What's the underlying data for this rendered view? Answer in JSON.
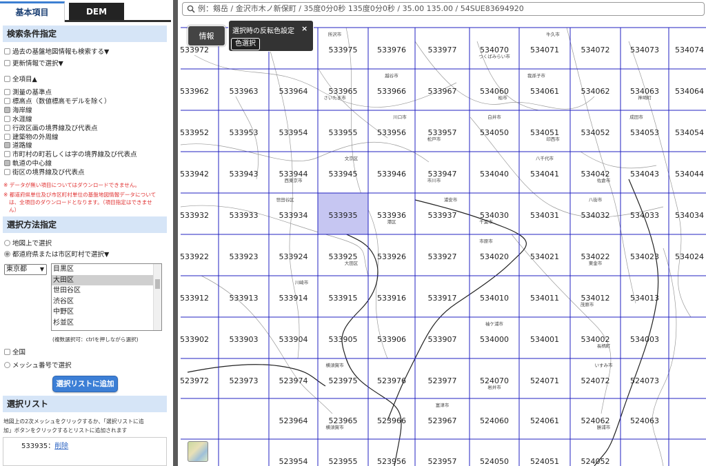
{
  "tabs": {
    "basic": "基本項目",
    "dem": "DEM"
  },
  "search_section": {
    "title": "検索条件指定",
    "past_info": "過去の基盤地図情報も検索する▼",
    "update_select": "更新情報で選択▼",
    "all_items": "全項目▲",
    "items": [
      {
        "label": "測量の基準点",
        "checked": false
      },
      {
        "label": "標高点（数値標高モデルを除く）",
        "checked": false
      },
      {
        "label": "海岸線",
        "checked": true
      },
      {
        "label": "水涯線",
        "checked": false
      },
      {
        "label": "行政区画の境界線及び代表点",
        "checked": false
      },
      {
        "label": "建築物の外周線",
        "checked": false
      },
      {
        "label": "道路線",
        "checked": true
      },
      {
        "label": "市町村の町若しくは字の境界線及び代表点",
        "checked": false
      },
      {
        "label": "軌道の中心線",
        "checked": true
      },
      {
        "label": "街区の境界線及び代表点",
        "checked": false
      }
    ],
    "note1": "※ データが無い項目についてはダウンロードできません。",
    "note2a": "※ 都道府県単位及び市区町村単位の基盤地図情報データについて",
    "note2b": "は、全項目のダウンロードとなります。（項目指定はできませ",
    "note2c": "ん）"
  },
  "method_section": {
    "title": "選択方法指定",
    "on_map": "地図上で選択",
    "by_pref": "都道府県または市区町村で選択▼",
    "pref_value": "東京都",
    "cities": [
      "目黒区",
      "大田区",
      "世田谷区",
      "渋谷区",
      "中野区",
      "杉並区"
    ],
    "selected_city": "大田区",
    "multi_hint": "(複数選択可：ctrlを押しながら選択)",
    "nationwide": "全国",
    "by_mesh": "メッシュ番号で選択",
    "add_button": "選択リストに追加"
  },
  "list_section": {
    "title": "選択リスト",
    "help1": "地図上の2次メッシュをクリックするか、「選択リストに追",
    "help2": "加」ボタンをクリックするとリストに追加されます",
    "item_code": "533935",
    "item_sep": "：",
    "item_delete": "削除"
  },
  "map": {
    "search_placeholder": "例：剱岳 / 金沢市木ノ新保町 / 35度0分0秒 135度0分0秒 / 35.00 135.00 / 54SUE83694920",
    "info_button": "情報",
    "popup_title": "選択時の反転色設定",
    "popup_close": "×",
    "popup_button": "色選択",
    "selected_mesh": "533935",
    "highlight_color": "#c6c6f2",
    "grid_color": "#2020c0",
    "mesh_labels": [
      {
        "t": "533972",
        "c": 0,
        "r": 0
      },
      {
        "t": "533975",
        "c": 3,
        "r": 0
      },
      {
        "t": "533976",
        "c": 4,
        "r": 0
      },
      {
        "t": "533977",
        "c": 5,
        "r": 0
      },
      {
        "t": "534070",
        "c": 6,
        "r": 0
      },
      {
        "t": "534071",
        "c": 7,
        "r": 0
      },
      {
        "t": "534072",
        "c": 8,
        "r": 0
      },
      {
        "t": "534073",
        "c": 9,
        "r": 0
      },
      {
        "t": "534074",
        "c": 10,
        "r": 0
      },
      {
        "t": "533962",
        "c": 0,
        "r": 1
      },
      {
        "t": "533963",
        "c": 1,
        "r": 1
      },
      {
        "t": "533964",
        "c": 2,
        "r": 1
      },
      {
        "t": "533965",
        "c": 3,
        "r": 1
      },
      {
        "t": "533966",
        "c": 4,
        "r": 1
      },
      {
        "t": "533967",
        "c": 5,
        "r": 1
      },
      {
        "t": "534060",
        "c": 6,
        "r": 1
      },
      {
        "t": "534061",
        "c": 7,
        "r": 1
      },
      {
        "t": "534062",
        "c": 8,
        "r": 1
      },
      {
        "t": "534063",
        "c": 9,
        "r": 1
      },
      {
        "t": "534064",
        "c": 10,
        "r": 1
      },
      {
        "t": "533952",
        "c": 0,
        "r": 2
      },
      {
        "t": "533953",
        "c": 1,
        "r": 2
      },
      {
        "t": "533954",
        "c": 2,
        "r": 2
      },
      {
        "t": "533955",
        "c": 3,
        "r": 2
      },
      {
        "t": "533956",
        "c": 4,
        "r": 2
      },
      {
        "t": "533957",
        "c": 5,
        "r": 2
      },
      {
        "t": "534050",
        "c": 6,
        "r": 2
      },
      {
        "t": "534051",
        "c": 7,
        "r": 2
      },
      {
        "t": "534052",
        "c": 8,
        "r": 2
      },
      {
        "t": "534053",
        "c": 9,
        "r": 2
      },
      {
        "t": "534054",
        "c": 10,
        "r": 2
      },
      {
        "t": "533942",
        "c": 0,
        "r": 3
      },
      {
        "t": "533943",
        "c": 1,
        "r": 3
      },
      {
        "t": "533944",
        "c": 2,
        "r": 3
      },
      {
        "t": "533945",
        "c": 3,
        "r": 3
      },
      {
        "t": "533946",
        "c": 4,
        "r": 3
      },
      {
        "t": "533947",
        "c": 5,
        "r": 3
      },
      {
        "t": "534040",
        "c": 6,
        "r": 3
      },
      {
        "t": "534041",
        "c": 7,
        "r": 3
      },
      {
        "t": "534042",
        "c": 8,
        "r": 3
      },
      {
        "t": "534043",
        "c": 9,
        "r": 3
      },
      {
        "t": "534044",
        "c": 10,
        "r": 3
      },
      {
        "t": "533932",
        "c": 0,
        "r": 4
      },
      {
        "t": "533933",
        "c": 1,
        "r": 4
      },
      {
        "t": "533934",
        "c": 2,
        "r": 4
      },
      {
        "t": "533935",
        "c": 3,
        "r": 4
      },
      {
        "t": "533936",
        "c": 4,
        "r": 4
      },
      {
        "t": "533937",
        "c": 5,
        "r": 4
      },
      {
        "t": "534030",
        "c": 6,
        "r": 4
      },
      {
        "t": "534031",
        "c": 7,
        "r": 4
      },
      {
        "t": "534032",
        "c": 8,
        "r": 4
      },
      {
        "t": "534033",
        "c": 9,
        "r": 4
      },
      {
        "t": "534034",
        "c": 10,
        "r": 4
      },
      {
        "t": "533922",
        "c": 0,
        "r": 5
      },
      {
        "t": "533923",
        "c": 1,
        "r": 5
      },
      {
        "t": "533924",
        "c": 2,
        "r": 5
      },
      {
        "t": "533925",
        "c": 3,
        "r": 5
      },
      {
        "t": "533926",
        "c": 4,
        "r": 5
      },
      {
        "t": "533927",
        "c": 5,
        "r": 5
      },
      {
        "t": "534020",
        "c": 6,
        "r": 5
      },
      {
        "t": "534021",
        "c": 7,
        "r": 5
      },
      {
        "t": "534022",
        "c": 8,
        "r": 5
      },
      {
        "t": "534023",
        "c": 9,
        "r": 5
      },
      {
        "t": "534024",
        "c": 10,
        "r": 5
      },
      {
        "t": "533912",
        "c": 0,
        "r": 6
      },
      {
        "t": "533913",
        "c": 1,
        "r": 6
      },
      {
        "t": "533914",
        "c": 2,
        "r": 6
      },
      {
        "t": "533915",
        "c": 3,
        "r": 6
      },
      {
        "t": "533916",
        "c": 4,
        "r": 6
      },
      {
        "t": "533917",
        "c": 5,
        "r": 6
      },
      {
        "t": "534010",
        "c": 6,
        "r": 6
      },
      {
        "t": "534011",
        "c": 7,
        "r": 6
      },
      {
        "t": "534012",
        "c": 8,
        "r": 6
      },
      {
        "t": "534013",
        "c": 9,
        "r": 6
      },
      {
        "t": "533902",
        "c": 0,
        "r": 7
      },
      {
        "t": "533903",
        "c": 1,
        "r": 7
      },
      {
        "t": "533904",
        "c": 2,
        "r": 7
      },
      {
        "t": "533905",
        "c": 3,
        "r": 7
      },
      {
        "t": "533906",
        "c": 4,
        "r": 7
      },
      {
        "t": "533907",
        "c": 5,
        "r": 7
      },
      {
        "t": "534000",
        "c": 6,
        "r": 7
      },
      {
        "t": "534001",
        "c": 7,
        "r": 7
      },
      {
        "t": "534002",
        "c": 8,
        "r": 7
      },
      {
        "t": "534003",
        "c": 9,
        "r": 7
      },
      {
        "t": "523972",
        "c": 0,
        "r": 8
      },
      {
        "t": "523973",
        "c": 1,
        "r": 8
      },
      {
        "t": "523974",
        "c": 2,
        "r": 8
      },
      {
        "t": "523975",
        "c": 3,
        "r": 8
      },
      {
        "t": "523976",
        "c": 4,
        "r": 8
      },
      {
        "t": "523977",
        "c": 5,
        "r": 8
      },
      {
        "t": "524070",
        "c": 6,
        "r": 8
      },
      {
        "t": "524071",
        "c": 7,
        "r": 8
      },
      {
        "t": "524072",
        "c": 8,
        "r": 8
      },
      {
        "t": "524073",
        "c": 9,
        "r": 8
      },
      {
        "t": "523964",
        "c": 2,
        "r": 9
      },
      {
        "t": "523965",
        "c": 3,
        "r": 9
      },
      {
        "t": "523966",
        "c": 4,
        "r": 9
      },
      {
        "t": "523967",
        "c": 5,
        "r": 9
      },
      {
        "t": "524060",
        "c": 6,
        "r": 9
      },
      {
        "t": "524061",
        "c": 7,
        "r": 9
      },
      {
        "t": "524062",
        "c": 8,
        "r": 9
      },
      {
        "t": "524063",
        "c": 9,
        "r": 9
      },
      {
        "t": "523954",
        "c": 2,
        "r": 10
      },
      {
        "t": "523955",
        "c": 3,
        "r": 10
      },
      {
        "t": "523956",
        "c": 4,
        "r": 10
      },
      {
        "t": "523957",
        "c": 5,
        "r": 10
      },
      {
        "t": "524050",
        "c": 6,
        "r": 10
      },
      {
        "t": "524051",
        "c": 7,
        "r": 10
      },
      {
        "t": "524052",
        "c": 8,
        "r": 10
      }
    ],
    "place_labels": [
      {
        "t": "所沢市",
        "c": 3,
        "r": 0
      },
      {
        "t": "つくばみらい市",
        "c": 6,
        "r": 0
      },
      {
        "t": "牛久市",
        "c": 7,
        "r": 0
      },
      {
        "t": "さいたま市",
        "c": 3,
        "r": 1
      },
      {
        "t": "越谷市",
        "c": 4,
        "r": 1
      },
      {
        "t": "柏市",
        "c": 6,
        "r": 1
      },
      {
        "t": "我孫子市",
        "c": 7,
        "r": 1
      },
      {
        "t": "神埼町",
        "c": 9,
        "r": 1
      },
      {
        "t": "川口市",
        "c": 4,
        "r": 2
      },
      {
        "t": "松戸市",
        "c": 5,
        "r": 2
      },
      {
        "t": "白井市",
        "c": 6,
        "r": 2
      },
      {
        "t": "印西市",
        "c": 7,
        "r": 2
      },
      {
        "t": "成田市",
        "c": 9,
        "r": 2
      },
      {
        "t": "西東京市",
        "c": 2,
        "r": 3
      },
      {
        "t": "文京区",
        "c": 3,
        "r": 3
      },
      {
        "t": "市川市",
        "c": 5,
        "r": 3
      },
      {
        "t": "八千代市",
        "c": 7,
        "r": 3
      },
      {
        "t": "佐倉市",
        "c": 8,
        "r": 3
      },
      {
        "t": "世田谷区",
        "c": 2,
        "r": 4
      },
      {
        "t": "港区",
        "c": 4,
        "r": 4
      },
      {
        "t": "浦安市",
        "c": 5,
        "r": 4
      },
      {
        "t": "千葉市",
        "c": 6,
        "r": 4
      },
      {
        "t": "八街市",
        "c": 8,
        "r": 4
      },
      {
        "t": "大田区",
        "c": 3,
        "r": 5
      },
      {
        "t": "市原市",
        "c": 6,
        "r": 5
      },
      {
        "t": "東金市",
        "c": 8,
        "r": 5
      },
      {
        "t": "川崎市",
        "c": 2,
        "r": 6
      },
      {
        "t": "茂原市",
        "c": 8,
        "r": 6
      },
      {
        "t": "袖ケ浦市",
        "c": 6,
        "r": 7
      },
      {
        "t": "長柄町",
        "c": 8,
        "r": 7
      },
      {
        "t": "横須賀市",
        "c": 3,
        "r": 8
      },
      {
        "t": "岩井市",
        "c": 6,
        "r": 8
      },
      {
        "t": "いすみ市",
        "c": 8,
        "r": 8
      },
      {
        "t": "横須賀市",
        "c": 3,
        "r": 9
      },
      {
        "t": "富津市",
        "c": 5,
        "r": 9
      },
      {
        "t": "勝浦市",
        "c": 8,
        "r": 9
      }
    ]
  }
}
